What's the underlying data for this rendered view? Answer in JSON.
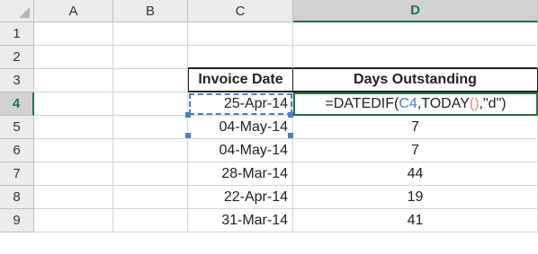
{
  "corner_label": "",
  "columns": [
    "A",
    "B",
    "C",
    "D"
  ],
  "selected_column": "D",
  "rows": [
    "1",
    "2",
    "3",
    "4",
    "5",
    "6",
    "7",
    "8",
    "9"
  ],
  "selected_row": "4",
  "headers": {
    "invoice_date": "Invoice Date",
    "days_outstanding": "Days Outstanding"
  },
  "active_cell_formula": {
    "prefix": "=DATEDIF(",
    "ref": "C4",
    "mid": ",TODAY",
    "paren": "()",
    "suffix": ",\"d\")"
  },
  "data_rows": [
    {
      "row": "4",
      "invoice_date": "25-Apr-14",
      "days_outstanding": ""
    },
    {
      "row": "5",
      "invoice_date": "04-May-14",
      "days_outstanding": "7"
    },
    {
      "row": "6",
      "invoice_date": "04-May-14",
      "days_outstanding": "7"
    },
    {
      "row": "7",
      "invoice_date": "28-Mar-14",
      "days_outstanding": "44"
    },
    {
      "row": "8",
      "invoice_date": "22-Apr-14",
      "days_outstanding": "19"
    },
    {
      "row": "9",
      "invoice_date": "31-Mar-14",
      "days_outstanding": "41"
    }
  ],
  "colors": {
    "accent": "#217346",
    "reference": "#4a7fc1",
    "paren": "#e08a7a",
    "header_bg": "#ececec"
  }
}
